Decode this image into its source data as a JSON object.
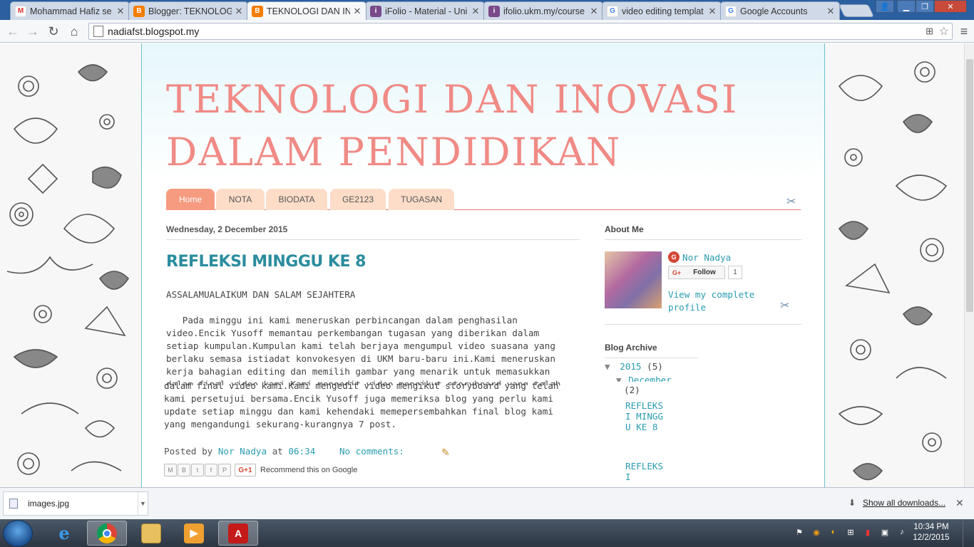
{
  "browser": {
    "tabs": [
      {
        "title": "Mohammad Hafiz se",
        "icon": "gmail-icon"
      },
      {
        "title": "Blogger: TEKNOLOGI",
        "icon": "blogger-icon"
      },
      {
        "title": "TEKNOLOGI DAN INO",
        "icon": "blogger-icon",
        "active": true
      },
      {
        "title": "iFolio - Material - Uni",
        "icon": "ifolio-icon"
      },
      {
        "title": "ifolio.ukm.my/course",
        "icon": "ifolio-icon"
      },
      {
        "title": "video editing templat",
        "icon": "google-icon"
      },
      {
        "title": "Google Accounts",
        "icon": "google-icon"
      }
    ],
    "url": "nadiafst.blogspot.my"
  },
  "blog": {
    "title": "TEKNOLOGI DAN INOVASI DALAM PENDIDIKAN",
    "nav": [
      "Home",
      "NOTA",
      "BIODATA",
      "GE2123",
      "TUGASAN"
    ],
    "post": {
      "date": "Wednesday, 2 December 2015",
      "title": "REFLEKSI MINGGU KE 8",
      "greeting": "ASSALAMUALAIKUM DAN SALAM SEJAHTERA",
      "body_part1": "   Pada minggu ini kami meneruskan perbincangan dalam penghasilan\nvideo.Encik Yusoff memantau perkembangan tugasan yang diberikan dalam\nsetiap kumpulan.Kumpulan kami telah berjaya mengumpul video suasana yang\nberlaku semasa istiadat konvokesyen di UKM baru-baru ini.Kami meneruskan\nkerja bahagian editing dan memilih gambar yang menarik untuk memasukkan\ndalam final video kami.Kami mengedit video mengikut storyboard yang telah",
      "body_part2": "dalam final video kami.Kami mengedit video mengikut storyboard yang telah\nkami persetujui bersama.Encik Yusoff juga memeriksa blog yang perlu kami\nupdate setiap minggu dan kami kehendaki memepersembahkan final blog kami\nyang mengandungi sekurang-kurangnya 7 post.",
      "posted_by_label": "Posted by",
      "author": "Nor Nadya",
      "at_label": "at",
      "time": "06:34",
      "comments": "No comments:",
      "recommend": "Recommend this on Google",
      "gplus": "G+1"
    },
    "sidebar": {
      "about_title": "About Me",
      "profile_name": "Nor Nadya",
      "follow_label": "Follow",
      "follow_count": "1",
      "view_profile": "View my complete profile",
      "archive_title": "Blog Archive",
      "year": "2015",
      "year_count": "(5)",
      "month": "December",
      "month_count": "(2)",
      "post1": "REFLEKSI MINGGU KE 8",
      "post2": "REFLEKSI"
    }
  },
  "downloads": {
    "file": "images.jpg",
    "show_all": "Show all downloads..."
  },
  "taskbar": {
    "time": "10:34 PM",
    "date": "12/2/2015"
  }
}
